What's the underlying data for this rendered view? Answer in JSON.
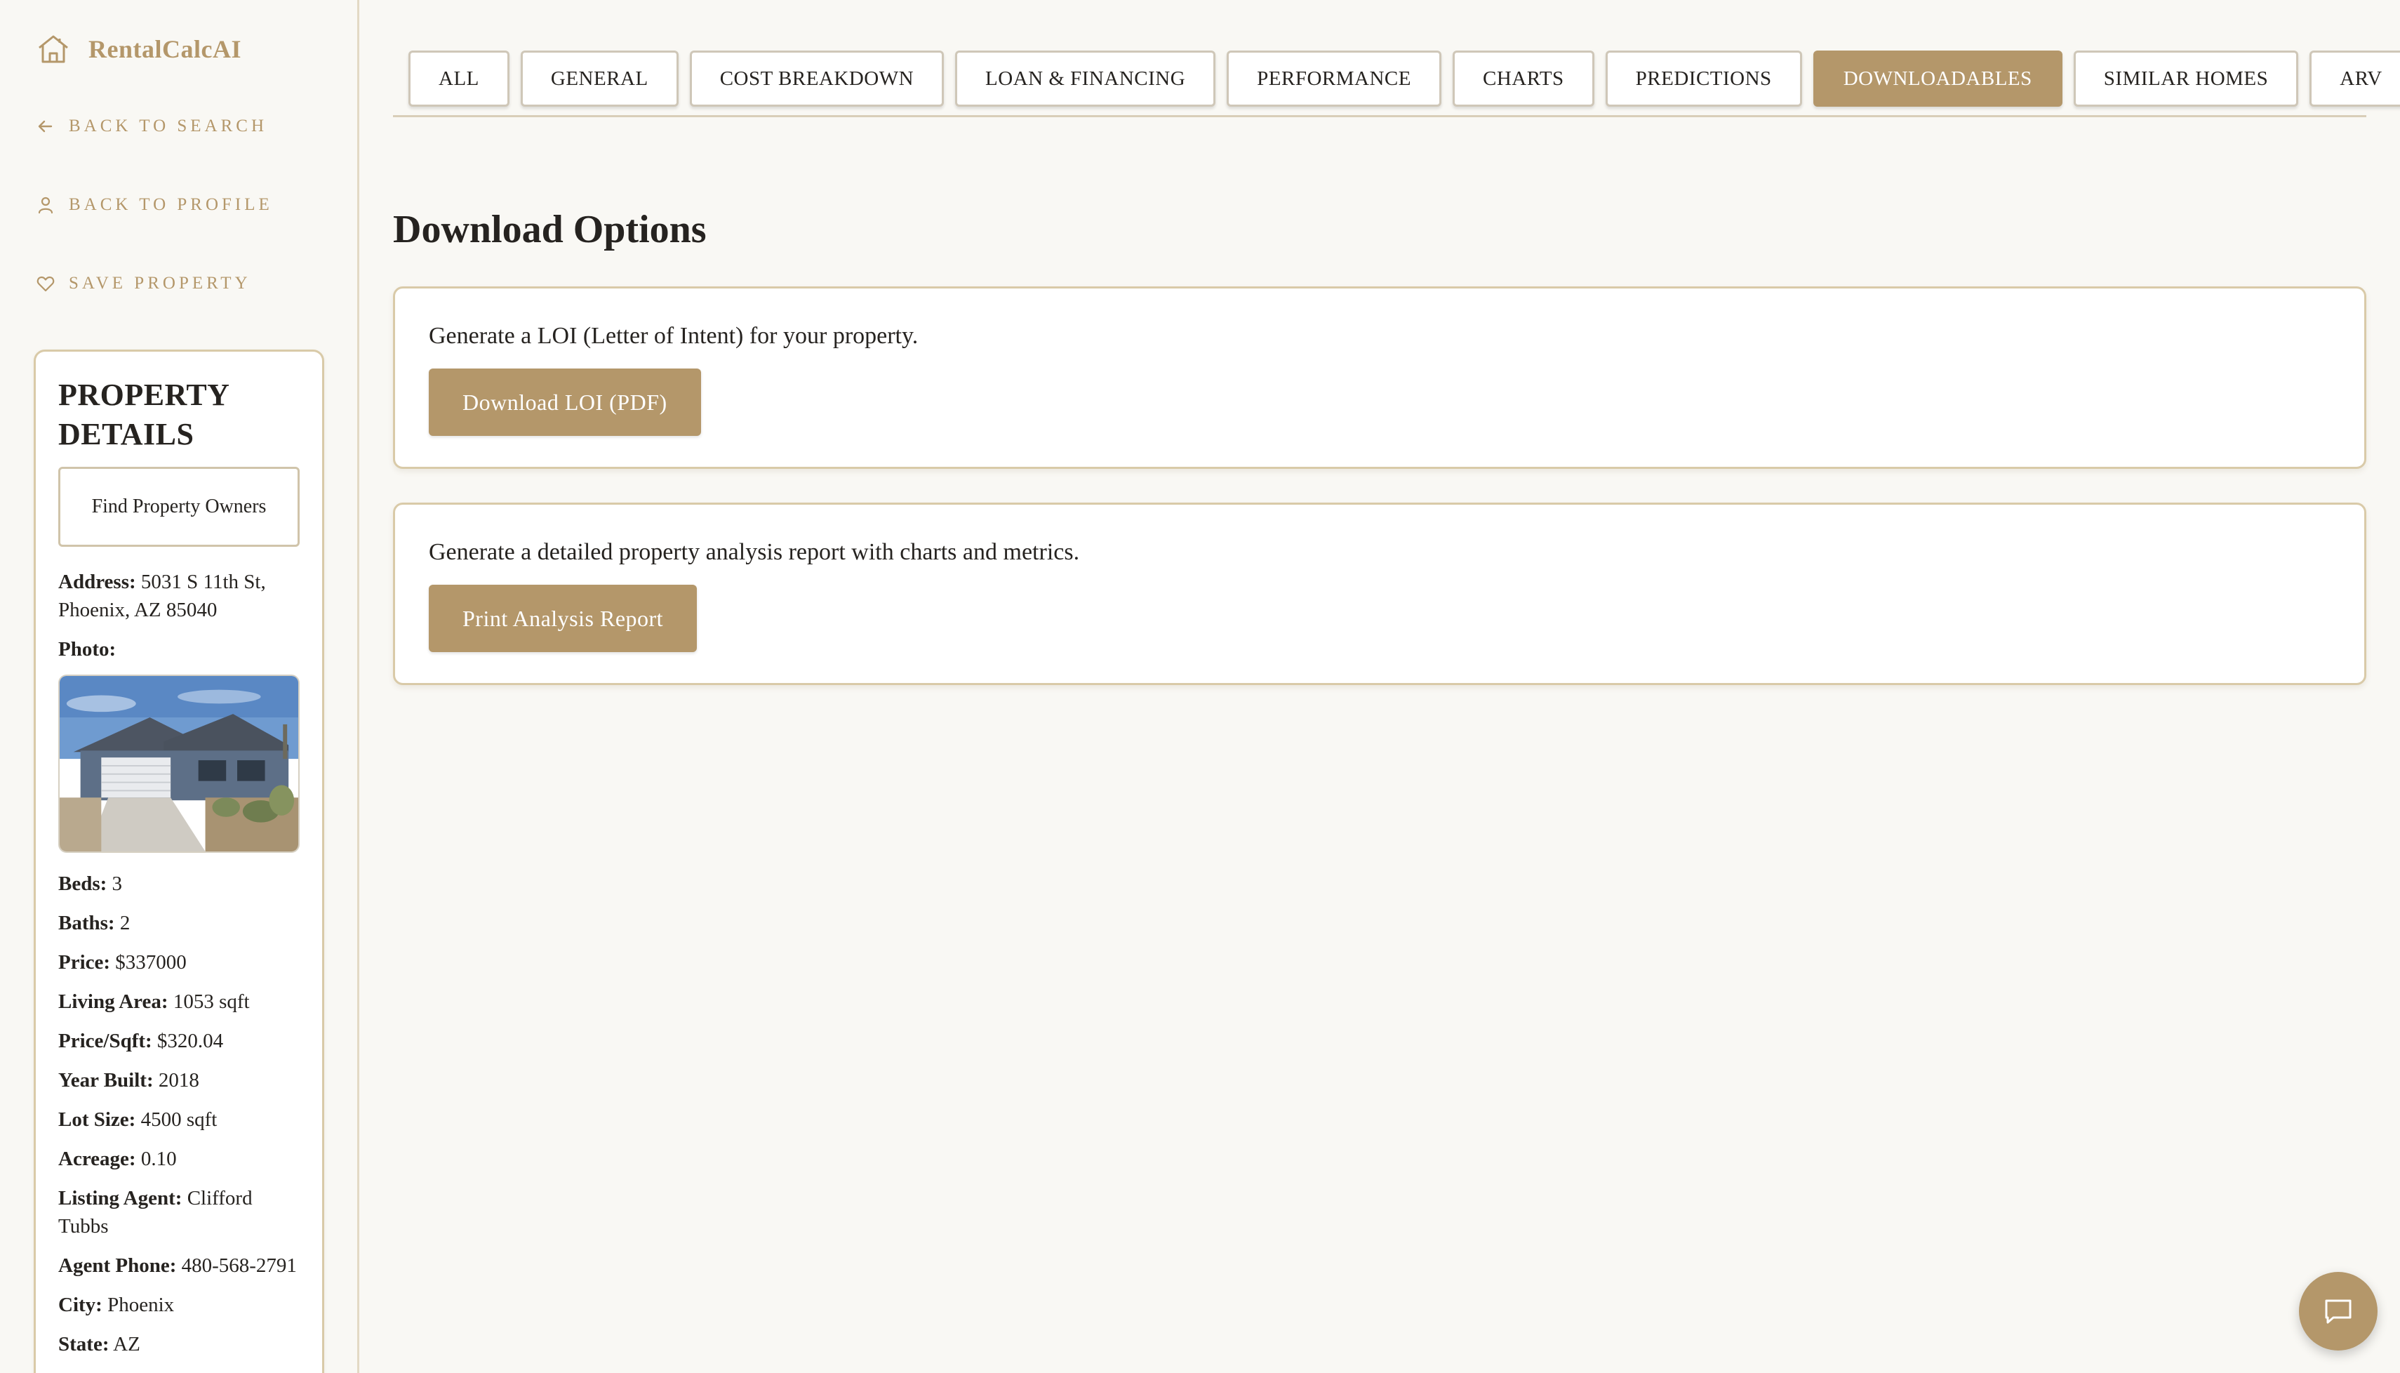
{
  "brand": {
    "name": "RentalCalcAI",
    "icon": "house-icon",
    "accent_color": "#b4976a"
  },
  "sidebar": {
    "links": [
      {
        "label": "BACK TO SEARCH",
        "icon": "arrow-left-icon"
      },
      {
        "label": "BACK TO PROFILE",
        "icon": "user-icon"
      },
      {
        "label": "SAVE PROPERTY",
        "icon": "heart-icon"
      }
    ],
    "details": {
      "title": "PROPERTY DETAILS",
      "find_owners_label": "Find Property Owners",
      "address_label": "Address:",
      "address": "5031 S 11th St, Phoenix, AZ 85040",
      "photo_label": "Photo:",
      "fields": [
        {
          "label": "Beds:",
          "value": "3"
        },
        {
          "label": "Baths:",
          "value": "2"
        },
        {
          "label": "Price:",
          "value": "$337000"
        },
        {
          "label": "Living Area:",
          "value": "1053 sqft"
        },
        {
          "label": "Price/Sqft:",
          "value": "$320.04"
        },
        {
          "label": "Year Built:",
          "value": "2018"
        },
        {
          "label": "Lot Size:",
          "value": "4500 sqft"
        },
        {
          "label": "Acreage:",
          "value": "0.10"
        },
        {
          "label": "Listing Agent:",
          "value": "Clifford Tubbs"
        },
        {
          "label": "Agent Phone:",
          "value": "480-568-2791"
        },
        {
          "label": "City:",
          "value": "Phoenix"
        },
        {
          "label": "State:",
          "value": "AZ"
        }
      ]
    }
  },
  "tabs": [
    {
      "label": "ALL",
      "active": false
    },
    {
      "label": "GENERAL",
      "active": false
    },
    {
      "label": "COST BREAKDOWN",
      "active": false
    },
    {
      "label": "LOAN & FINANCING",
      "active": false
    },
    {
      "label": "PERFORMANCE",
      "active": false
    },
    {
      "label": "CHARTS",
      "active": false
    },
    {
      "label": "PREDICTIONS",
      "active": false
    },
    {
      "label": "DOWNLOADABLES",
      "active": true
    },
    {
      "label": "SIMILAR HOMES",
      "active": false
    },
    {
      "label": "ARV",
      "active": false
    }
  ],
  "main": {
    "title": "Download Options",
    "options": [
      {
        "description": "Generate a LOI (Letter of Intent) for your property.",
        "button_label": "Download LOI (PDF)"
      },
      {
        "description": "Generate a detailed property analysis report with charts and metrics.",
        "button_label": "Print Analysis Report"
      }
    ]
  },
  "chat": {
    "icon": "chat-icon"
  }
}
